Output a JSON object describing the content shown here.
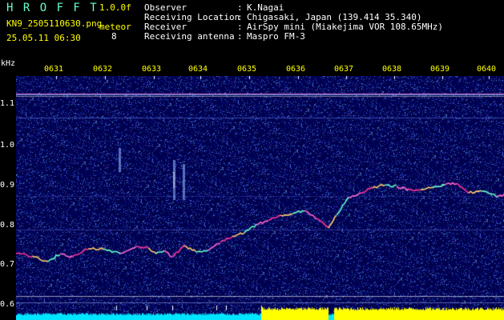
{
  "header": {
    "app_title": "H R O F F T",
    "version": "1.0.0f",
    "filename": "KN9_2505110630.png",
    "datetime": "25.05.11 06:30",
    "meteor_label": "meteor",
    "meteor_count": "8",
    "info": [
      {
        "key": "Observer",
        "value": "K.Nagai"
      },
      {
        "key": "Receiving Location",
        "value": "Chigasaki, Japan (139.414 35.340)"
      },
      {
        "key": "Receiver",
        "value": "AirSpy mini (Miakejima VOR 108.65MHz)"
      },
      {
        "key": "Receiving antenna",
        "value": "Maspro FM-3"
      }
    ]
  },
  "spectrogram": {
    "yunit": "kHz",
    "time_ticks": [
      "0631",
      "0632",
      "0633",
      "0634",
      "0635",
      "0636",
      "0637",
      "0638",
      "0639",
      "0640"
    ],
    "freq_ticks": [
      "1.1",
      "1.0",
      "0.9",
      "0.8",
      "0.7",
      "0.6"
    ],
    "colors": {
      "background": "#000055",
      "signal": "#ff3399",
      "level_bar_cyan": "#00e5ff",
      "level_bar_yellow": "#ffff00"
    }
  }
}
